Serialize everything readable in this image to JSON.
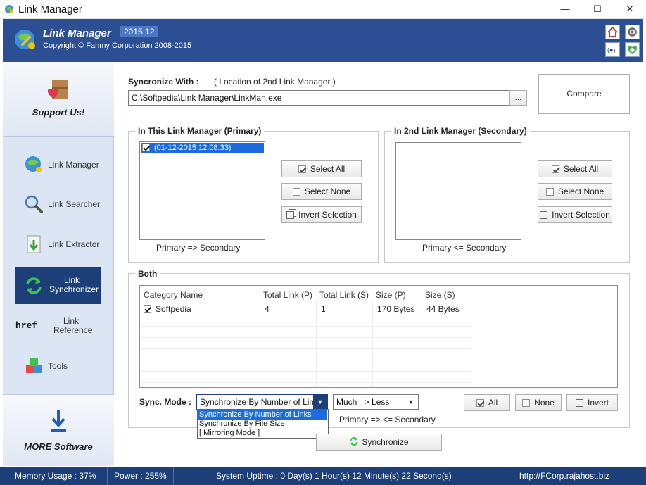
{
  "window": {
    "title": "Link Manager",
    "controls": {
      "minimize": "—",
      "maximize": "☐",
      "close": "✕"
    }
  },
  "header": {
    "app_name": "Link Manager",
    "version": "2015.12",
    "copyright": "Copyright © Fahmy Corporation 2008-2015",
    "buttons": [
      "home-icon",
      "rss-icon",
      "settings-icon",
      "add-icon"
    ]
  },
  "sidebar": {
    "support_label": "Support Us!",
    "more_label": "MORE Software",
    "items": [
      {
        "label": "Link Manager",
        "icon": "globe-link-icon",
        "active": false
      },
      {
        "label": "Link Searcher",
        "icon": "magnifier-icon",
        "active": false
      },
      {
        "label": "Link Extractor",
        "icon": "extract-icon",
        "active": false
      },
      {
        "label": "Link\nSynchronizer",
        "label_1": "Link",
        "label_2": "Synchronizer",
        "icon": "sync-icon",
        "active": true
      },
      {
        "label_1": "Link",
        "label_2": "Reference",
        "icon_text": "href",
        "icon": "href-icon",
        "active": false
      },
      {
        "label": "Tools",
        "icon": "tools-icon",
        "active": false
      }
    ]
  },
  "sync_with": {
    "label": "Syncronize With :",
    "hint": "( Location of 2nd Link Manager )",
    "path": "C:\\Softpedia\\Link Manager\\LinkMan.exe",
    "browse_label": "...",
    "compare_label": "Compare"
  },
  "primary": {
    "title": "In This Link Manager (Primary)",
    "items": [
      {
        "text": "(01-12-2015 12.08.33)",
        "checked": true
      }
    ],
    "select_all": "Select All",
    "select_none": "Select None",
    "invert": "Invert Selection",
    "direction": "Primary => Secondary"
  },
  "secondary": {
    "title": "In 2nd Link Manager (Secondary)",
    "items": [],
    "select_all": "Select All",
    "select_none": "Select None",
    "invert": "Invert Selection",
    "direction": "Primary <= Secondary"
  },
  "both": {
    "title": "Both",
    "columns": [
      "Category Name",
      "Total Link (P)",
      "Total Link (S)",
      "Size (P)",
      "Size (S)"
    ],
    "rows": [
      {
        "checked": true,
        "cells": [
          "Softpedia",
          "4",
          "1",
          "170 Bytes",
          "44 Bytes"
        ]
      }
    ]
  },
  "sync_mode": {
    "label": "Sync. Mode :",
    "selected": "Synchronize By Number of Links",
    "options": [
      "Synchronize By Number of Links",
      "Synchronize By File Size",
      "[ Mirroring Mode ]"
    ],
    "direction_selected": "Much => Less",
    "direction_text": "Primary => <= Secondary",
    "all_label": "All",
    "none_label": "None",
    "invert_label": "Invert",
    "synchronize_label": "Synchronize"
  },
  "status": {
    "memory": "Memory Usage : 37%",
    "power": "Power : 255%",
    "uptime": "System Uptime : 0 Day(s) 1 Hour(s) 12 Minute(s) 22 Second(s)",
    "url": "http://FCorp.rajahost.biz"
  },
  "colors": {
    "banner": "#2c4f93",
    "status_bar": "#1c3f7a",
    "selection": "#1c6ce0",
    "sidebar": "#dbe5f4"
  }
}
